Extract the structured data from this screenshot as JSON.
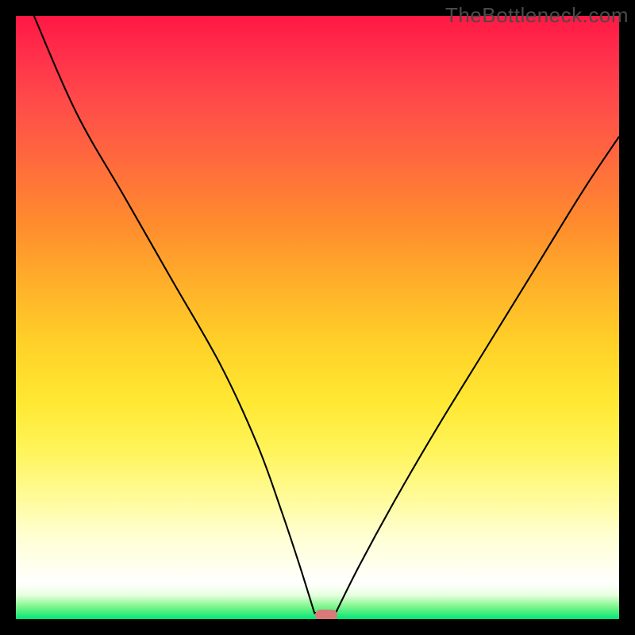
{
  "watermark": "TheBottleneck.com",
  "chart_data": {
    "type": "line",
    "title": "",
    "xlabel": "",
    "ylabel": "",
    "xlim": [
      0,
      100
    ],
    "ylim": [
      0,
      100
    ],
    "grid": false,
    "series": [
      {
        "name": "bottleneck-curve",
        "x": [
          3,
          10,
          18,
          26,
          34,
          40,
          44,
          47,
          49.5,
          53,
          57,
          63,
          70,
          78,
          86,
          94,
          100
        ],
        "values": [
          100,
          84,
          70,
          56,
          42,
          29,
          18,
          9,
          1,
          1,
          9,
          20,
          32,
          45,
          58,
          71,
          80
        ]
      }
    ],
    "annotations": [
      {
        "type": "marker",
        "name": "optimal-marker",
        "x": 51.5,
        "y": 0.7,
        "color": "#d87a7a"
      }
    ],
    "background": {
      "type": "vertical-gradient",
      "stops": [
        {
          "pos": 0,
          "color": "#ff1744"
        },
        {
          "pos": 45,
          "color": "#ffb22a"
        },
        {
          "pos": 70,
          "color": "#fff45a"
        },
        {
          "pos": 94,
          "color": "#ffffff"
        },
        {
          "pos": 100,
          "color": "#00e676"
        }
      ]
    }
  },
  "colors": {
    "frame": "#000000",
    "curve": "#000000",
    "watermark": "#4a4a4a",
    "marker": "#d87a7a"
  }
}
